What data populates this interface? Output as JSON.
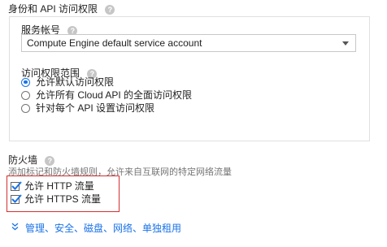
{
  "identity": {
    "title": "身份和 API 访问权限",
    "service_account_label": "服务帐号",
    "service_account_value": "Compute Engine default service account",
    "scopes_label": "访问权限范围",
    "scopes": [
      {
        "label": "允许默认访问权限",
        "checked": true
      },
      {
        "label": "允许所有 Cloud API 的全面访问权限",
        "checked": false
      },
      {
        "label": "针对每个 API 设置访问权限",
        "checked": false
      }
    ]
  },
  "firewall": {
    "title": "防火墙",
    "description": "添加标记和防火墙规则，允许来自互联网的特定网络流量",
    "options": [
      {
        "label": "允许 HTTP 流量",
        "checked": true
      },
      {
        "label": "允许 HTTPS 流量",
        "checked": true
      }
    ]
  },
  "more_link": "管理、安全、磁盘、网络、单独租用",
  "colors": {
    "accent": "#1a73e8",
    "highlight": "#d32f2f"
  }
}
